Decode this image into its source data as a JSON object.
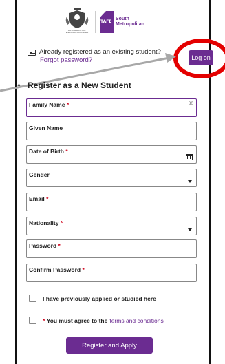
{
  "header": {
    "crest_caption": "GOVERNMENT OF WESTERN AUSTRALIA",
    "tafe_mark": "TAFE",
    "tafe_line1": "South",
    "tafe_line2": "Metropolitan"
  },
  "returning": {
    "prompt": "Already registered as an existing student?",
    "forgot_link": "Forgot password?",
    "logon_label": "Log on"
  },
  "section_title": "Register as a New Student",
  "fields": {
    "family_name": {
      "label": "Family Name",
      "required_mark": "*",
      "counter": "80"
    },
    "given_name": {
      "label": "Given Name"
    },
    "dob": {
      "label": "Date of Birth",
      "required_mark": "*"
    },
    "gender": {
      "label": "Gender"
    },
    "email": {
      "label": "Email",
      "required_mark": "*"
    },
    "nationality": {
      "label": "Nationality",
      "required_mark": "*"
    },
    "password": {
      "label": "Password",
      "required_mark": "*"
    },
    "confirm_password": {
      "label": "Confirm Password",
      "required_mark": "*"
    }
  },
  "checks": {
    "previously_applied": "I have previously applied or studied here",
    "agree_mark": "*",
    "agree_text": "You must agree to the",
    "terms_link": "terms and conditions"
  },
  "submit_label": "Register and Apply",
  "colors": {
    "brand": "#6b2c91",
    "annotation_ring": "#e40000",
    "annotation_arrow": "#a8a8a8",
    "required": "#d0021b"
  }
}
